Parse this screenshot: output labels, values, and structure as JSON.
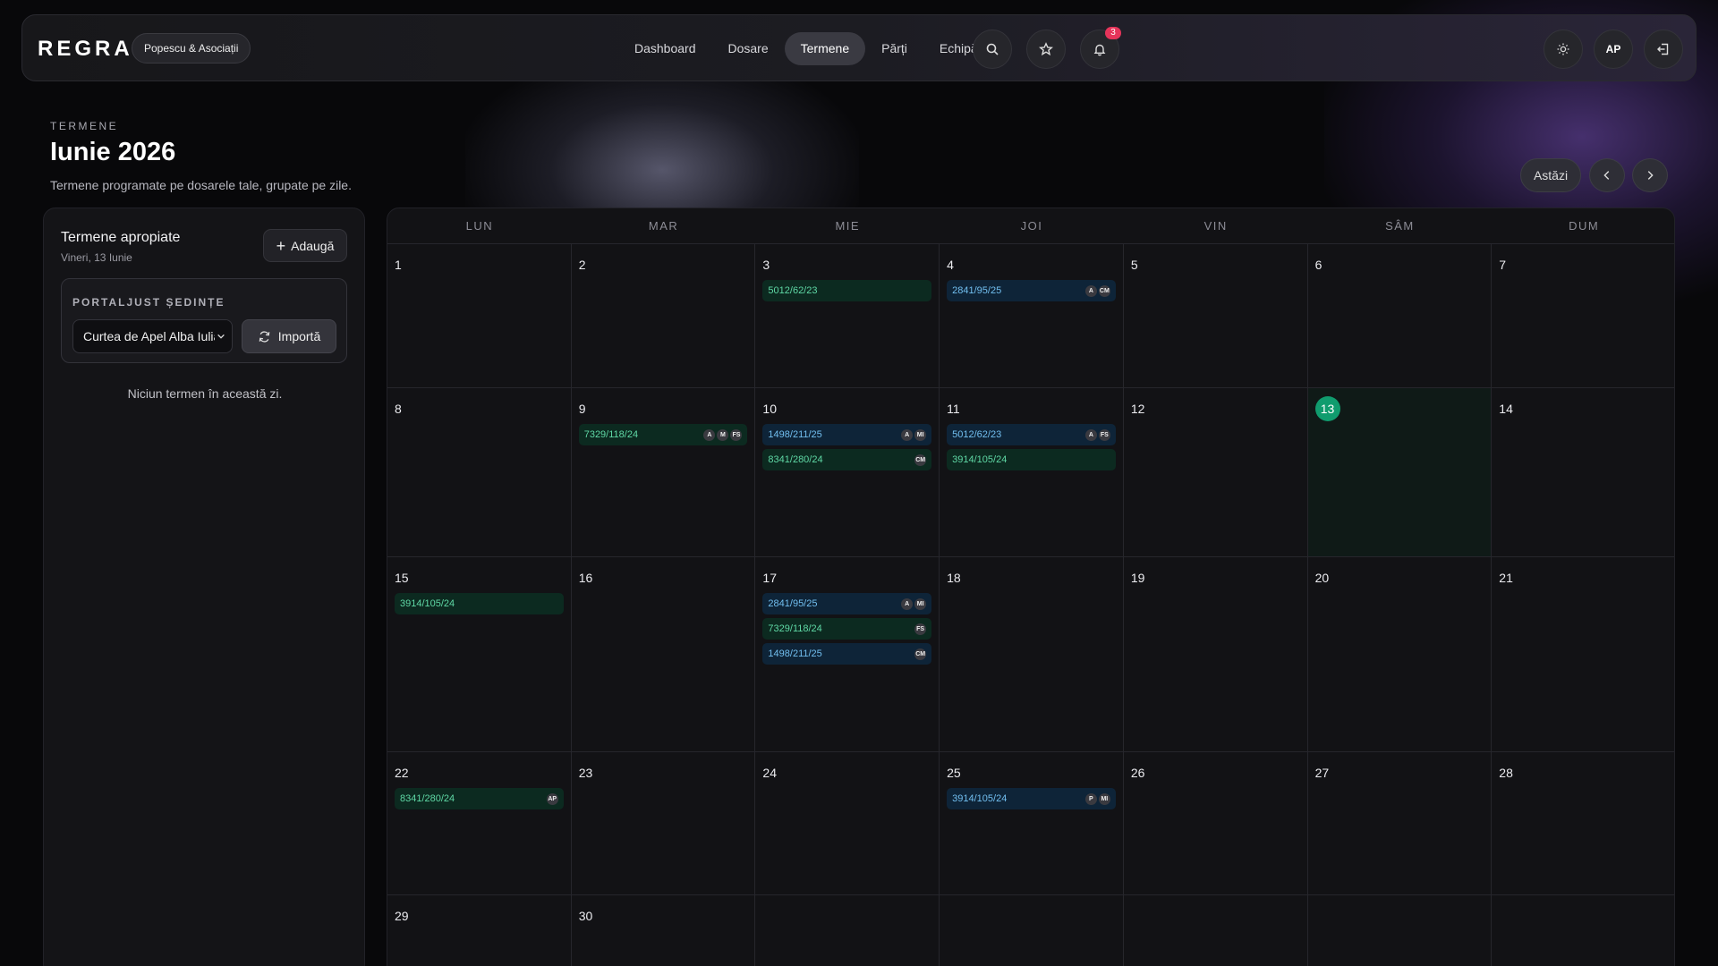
{
  "app": {
    "logo": "REGRA",
    "firm": "Popescu & Asociații"
  },
  "nav": {
    "items": [
      "Dashboard",
      "Dosare",
      "Termene",
      "Părți",
      "Echipă"
    ],
    "active": "Termene",
    "notifications_count": "3",
    "user_initials": "AP"
  },
  "header": {
    "eyebrow": "TERMENE",
    "title": "Iunie 2026",
    "subtitle": "Termene programate pe dosarele tale, grupate pe zile.",
    "today_button": "Astăzi"
  },
  "sidebar": {
    "title": "Termene apropiate",
    "date": "Vineri, 13 Iunie",
    "add_label": "Adaugă",
    "portal_label": "PORTALJUST ȘEDINȚE",
    "court_value": "Curtea de Apel Alba Iulia",
    "import_label": "Importă",
    "empty_message": "Niciun termen în această zi."
  },
  "calendar": {
    "weekdays": [
      "LUN",
      "MAR",
      "MIE",
      "JOI",
      "VIN",
      "SÂM",
      "DUM"
    ],
    "today": "13",
    "weeks": [
      [
        {
          "day": "1",
          "events": []
        },
        {
          "day": "2",
          "events": []
        },
        {
          "day": "3",
          "events": [
            {
              "case": "5012/62/23",
              "color": "green",
              "tags": []
            }
          ]
        },
        {
          "day": "4",
          "events": [
            {
              "case": "2841/95/25",
              "color": "blue",
              "tags": [
                "A",
                "CM"
              ]
            }
          ]
        },
        {
          "day": "5",
          "events": []
        },
        {
          "day": "6",
          "events": []
        },
        {
          "day": "7",
          "events": []
        }
      ],
      [
        {
          "day": "8",
          "events": []
        },
        {
          "day": "9",
          "events": [
            {
              "case": "7329/118/24",
              "color": "green",
              "tags": [
                "A",
                "M",
                "FS"
              ]
            }
          ]
        },
        {
          "day": "10",
          "events": [
            {
              "case": "1498/211/25",
              "color": "blue",
              "tags": [
                "A",
                "MI"
              ]
            },
            {
              "case": "8341/280/24",
              "color": "green",
              "tags": [
                "CM"
              ]
            }
          ]
        },
        {
          "day": "11",
          "events": [
            {
              "case": "5012/62/23",
              "color": "blue",
              "tags": [
                "A",
                "FS"
              ]
            },
            {
              "case": "3914/105/24",
              "color": "green",
              "tags": []
            }
          ]
        },
        {
          "day": "12",
          "events": []
        },
        {
          "day": "13",
          "events": []
        },
        {
          "day": "14",
          "events": []
        }
      ],
      [
        {
          "day": "15",
          "events": [
            {
              "case": "3914/105/24",
              "color": "green",
              "tags": []
            }
          ]
        },
        {
          "day": "16",
          "events": []
        },
        {
          "day": "17",
          "events": [
            {
              "case": "2841/95/25",
              "color": "blue",
              "tags": [
                "A",
                "MI"
              ]
            },
            {
              "case": "7329/118/24",
              "color": "green",
              "tags": [
                "FS"
              ]
            },
            {
              "case": "1498/211/25",
              "color": "blue",
              "tags": [
                "CM"
              ]
            }
          ]
        },
        {
          "day": "18",
          "events": []
        },
        {
          "day": "19",
          "events": []
        },
        {
          "day": "20",
          "events": []
        },
        {
          "day": "21",
          "events": []
        }
      ],
      [
        {
          "day": "22",
          "events": [
            {
              "case": "8341/280/24",
              "color": "green",
              "tags": [
                "AP"
              ]
            }
          ]
        },
        {
          "day": "23",
          "events": []
        },
        {
          "day": "24",
          "events": []
        },
        {
          "day": "25",
          "events": [
            {
              "case": "3914/105/24",
              "color": "blue",
              "tags": [
                "P",
                "MI"
              ]
            }
          ]
        },
        {
          "day": "26",
          "events": []
        },
        {
          "day": "27",
          "events": []
        },
        {
          "day": "28",
          "events": []
        }
      ],
      [
        {
          "day": "29",
          "events": []
        },
        {
          "day": "30",
          "events": []
        },
        {
          "day": "",
          "events": []
        },
        {
          "day": "",
          "events": []
        },
        {
          "day": "",
          "events": []
        },
        {
          "day": "",
          "events": []
        },
        {
          "day": "",
          "events": []
        }
      ]
    ]
  },
  "icons": {
    "search": "search-icon",
    "favorites": "star-icon",
    "notifications": "bell-icon",
    "theme": "sun-icon",
    "logout": "logout-icon",
    "prev": "chevron-left-icon",
    "next": "chevron-right-icon",
    "import": "refresh-icon",
    "add": "plus-icon"
  },
  "colors": {
    "accent_today": "#109c6e",
    "event_green_bg": "#0c2a20",
    "event_green_text": "#5fd8a5",
    "event_blue_bg": "#0e2438",
    "event_blue_text": "#72bff0",
    "badge": "#e5345a"
  }
}
